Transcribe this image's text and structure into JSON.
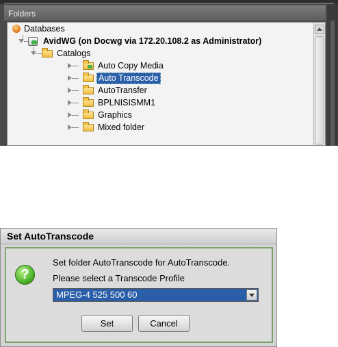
{
  "folders_panel": {
    "header": "Folders",
    "tree": {
      "root_label": "Databases",
      "server_label": "AvidWG (on Docwg via 172.20.108.2 as Administrator)",
      "catalogs_label": "Catalogs",
      "items": [
        {
          "label": "Auto Copy Media",
          "selected": false,
          "icon": "folder-shared-icon"
        },
        {
          "label": "Auto Transcode",
          "selected": true,
          "icon": "folder-icon"
        },
        {
          "label": "AutoTransfer",
          "selected": false,
          "icon": "folder-icon"
        },
        {
          "label": "BPLNISISMM1",
          "selected": false,
          "icon": "folder-icon"
        },
        {
          "label": "Graphics",
          "selected": false,
          "icon": "folder-icon"
        },
        {
          "label": "Mixed folder",
          "selected": false,
          "icon": "folder-icon"
        }
      ]
    }
  },
  "dialog": {
    "title": "Set AutoTranscode",
    "message_line1": "Set folder AutoTranscode for AutoTranscode.",
    "message_line2": "Please select a Transcode Profile",
    "profile_value": "MPEG-4 525 500 60",
    "set_label": "Set",
    "cancel_label": "Cancel"
  },
  "colors": {
    "selection": "#2a5ea8",
    "panel_dark": "#4a4a4a",
    "dialog_border_green": "#7aa36b"
  }
}
